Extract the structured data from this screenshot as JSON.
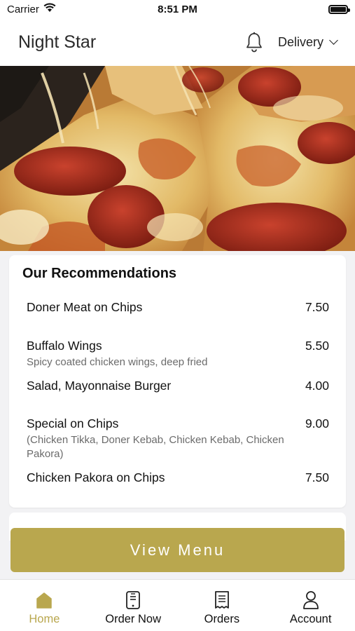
{
  "status_bar": {
    "carrier": "Carrier",
    "time": "8:51 PM"
  },
  "header": {
    "title": "Night Star",
    "delivery_label": "Delivery"
  },
  "recommendations": {
    "title": "Our Recommendations",
    "items": [
      {
        "name": "Doner Meat on Chips",
        "price": "7.50",
        "description": ""
      },
      {
        "name": "Buffalo Wings",
        "price": "5.50",
        "description": "Spicy coated chicken wings, deep fried"
      },
      {
        "name": "Salad, Mayonnaise Burger",
        "price": "4.00",
        "description": ""
      },
      {
        "name": "Special on Chips",
        "price": "9.00",
        "description": "(Chicken Tikka, Doner Kebab, Chicken Kebab, Chicken Pakora)"
      },
      {
        "name": "Chicken Pakora on Chips",
        "price": "7.50",
        "description": ""
      }
    ]
  },
  "view_menu_label": "View Menu",
  "tabs": [
    {
      "label": "Home",
      "icon": "home-icon",
      "active": true
    },
    {
      "label": "Order Now",
      "icon": "order-now-icon",
      "active": false
    },
    {
      "label": "Orders",
      "icon": "receipt-icon",
      "active": false
    },
    {
      "label": "Account",
      "icon": "account-icon",
      "active": false
    }
  ],
  "colors": {
    "accent": "#b9a74e",
    "background": "#f2f2f4",
    "card": "#ffffff",
    "muted_text": "#6b6b6b"
  }
}
